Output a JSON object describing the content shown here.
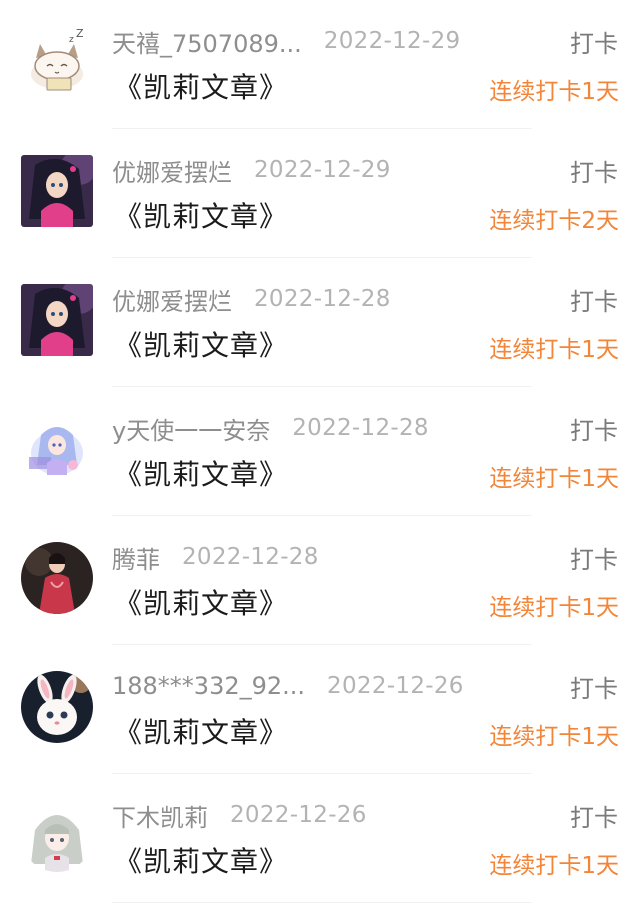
{
  "records": [
    {
      "username": "天禧_7507089...",
      "date": "2022-12-29",
      "article": "《凯莉文章》",
      "action": "打卡",
      "streak": "连续打卡1天",
      "avatar_icon": "cartoon-cat-avatar"
    },
    {
      "username": "优娜爱摆烂",
      "date": "2022-12-29",
      "article": "《凯莉文章》",
      "action": "打卡",
      "streak": "连续打卡2天",
      "avatar_icon": "anime-girl-pink-dress-avatar"
    },
    {
      "username": "优娜爱摆烂",
      "date": "2022-12-28",
      "article": "《凯莉文章》",
      "action": "打卡",
      "streak": "连续打卡1天",
      "avatar_icon": "anime-girl-pink-dress-avatar"
    },
    {
      "username": "y天使一一安奈",
      "date": "2022-12-28",
      "article": "《凯莉文章》",
      "action": "打卡",
      "streak": "连续打卡1天",
      "avatar_icon": "anime-girl-blue-hair-avatar"
    },
    {
      "username": "腾菲",
      "date": "2022-12-28",
      "article": "《凯莉文章》",
      "action": "打卡",
      "streak": "连续打卡1天",
      "avatar_icon": "woman-red-dress-avatar"
    },
    {
      "username": "188***332_92...",
      "date": "2022-12-26",
      "article": "《凯莉文章》",
      "action": "打卡",
      "streak": "连续打卡1天",
      "avatar_icon": "white-rabbit-avatar"
    },
    {
      "username": "下木凯莉",
      "date": "2022-12-26",
      "article": "《凯莉文章》",
      "action": "打卡",
      "streak": "连续打卡1天",
      "avatar_icon": "anime-girl-gray-hair-avatar"
    }
  ],
  "colors": {
    "username": "#8e8e8e",
    "date": "#b3b3b3",
    "article": "#1b1b1b",
    "action": "#7a7a7a",
    "streak": "#f38538"
  }
}
